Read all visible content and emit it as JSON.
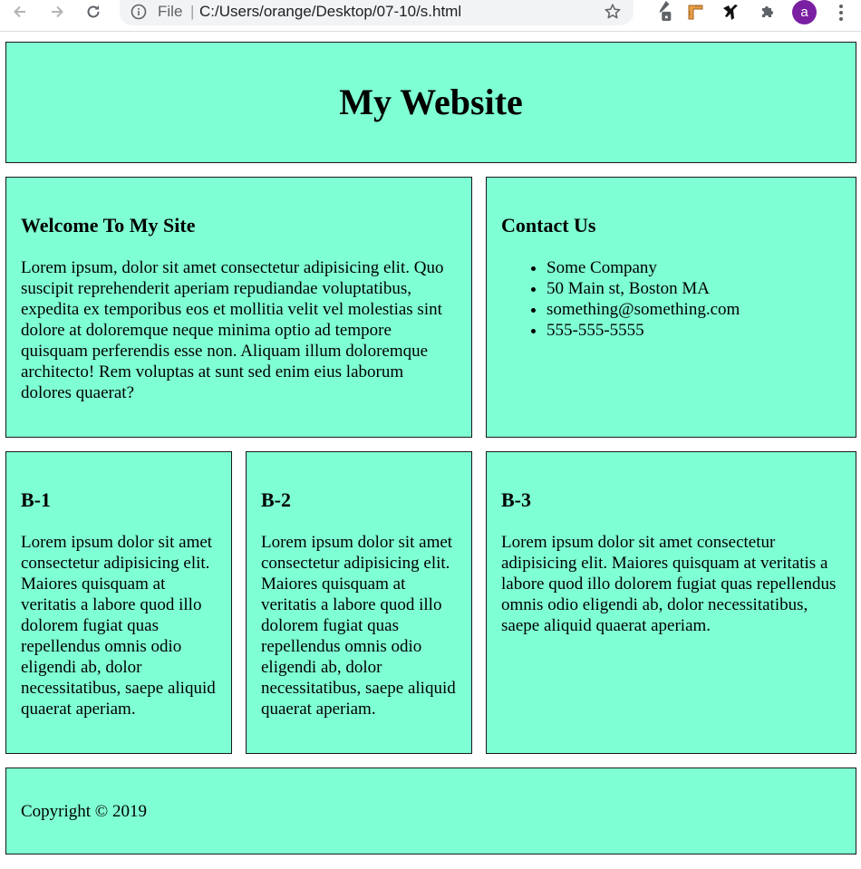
{
  "browser": {
    "scheme_label": "File",
    "separator": "|",
    "url": "C:/Users/orange/Desktop/07-10/s.html",
    "avatar_letter": "a"
  },
  "header": {
    "title": "My Website"
  },
  "welcome": {
    "heading": "Welcome To My Site",
    "body": "Lorem ipsum, dolor sit amet consectetur adipisicing elit. Quo suscipit reprehenderit aperiam repudiandae voluptatibus, expedita ex temporibus eos et mollitia velit vel molestias sint dolore at doloremque neque minima optio ad tempore quisquam perferendis esse non. Aliquam illum doloremque architecto! Rem voluptas at sunt sed enim eius laborum dolores quaerat?"
  },
  "contact": {
    "heading": "Contact Us",
    "items": [
      "Some Company",
      "50 Main st, Boston MA",
      "something@something.com",
      "555-555-5555"
    ]
  },
  "boxes": [
    {
      "heading": "B-1",
      "body": "Lorem ipsum dolor sit amet consectetur adipisicing elit. Maiores quisquam at veritatis a labore quod illo dolorem fugiat quas repellendus omnis odio eligendi ab, dolor necessitatibus, saepe aliquid quaerat aperiam."
    },
    {
      "heading": "B-2",
      "body": "Lorem ipsum dolor sit amet consectetur adipisicing elit. Maiores quisquam at veritatis a labore quod illo dolorem fugiat quas repellendus omnis odio eligendi ab, dolor necessitatibus, saepe aliquid quaerat aperiam."
    },
    {
      "heading": "B-3",
      "body": "Lorem ipsum dolor sit amet consectetur adipisicing elit. Maiores quisquam at veritatis a labore quod illo dolorem fugiat quas repellendus omnis odio eligendi ab, dolor necessitatibus, saepe aliquid quaerat aperiam."
    }
  ],
  "footer": {
    "copyright": "Copyright © 2019"
  },
  "colors": {
    "box_background": "#7fffd4",
    "border": "#1a1a1a"
  }
}
